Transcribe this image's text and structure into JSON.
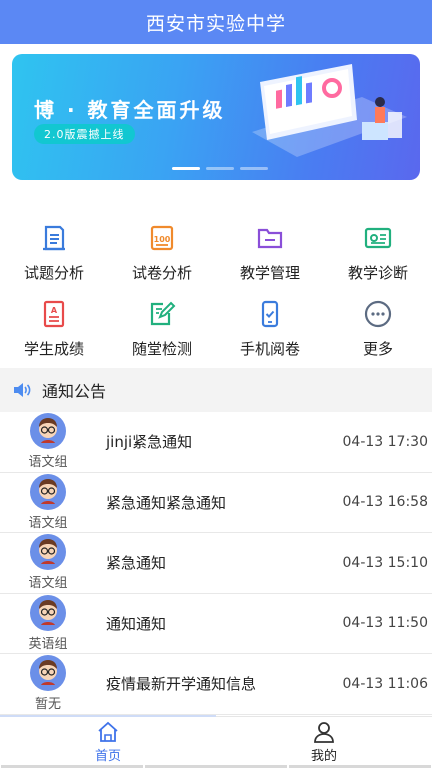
{
  "header": {
    "title": "西安市实验中学"
  },
  "banner": {
    "title": "博 · 教育全面升级",
    "badge": "2.0版震撼上线"
  },
  "grid": [
    {
      "label": "试题分析",
      "icon": "document-icon",
      "color": "#3a7bdc"
    },
    {
      "label": "试卷分析",
      "icon": "score-100-icon",
      "color": "#f08a2c"
    },
    {
      "label": "教学管理",
      "icon": "folder-icon",
      "color": "#8a4fd8"
    },
    {
      "label": "教学诊断",
      "icon": "id-card-icon",
      "color": "#21b07e"
    },
    {
      "label": "学生成绩",
      "icon": "report-icon",
      "color": "#e84a4a"
    },
    {
      "label": "随堂检测",
      "icon": "edit-icon",
      "color": "#21b07e"
    },
    {
      "label": "手机阅卷",
      "icon": "phone-check-icon",
      "color": "#3a7bdc"
    },
    {
      "label": "更多",
      "icon": "more-icon",
      "color": "#5c6b82"
    }
  ],
  "notice": {
    "label": "通知公告"
  },
  "items": [
    {
      "group": "语文组",
      "title": "jinji紧急通知",
      "time": "04-13 17:30"
    },
    {
      "group": "语文组",
      "title": "紧急通知紧急通知",
      "time": "04-13 16:58"
    },
    {
      "group": "语文组",
      "title": "紧急通知",
      "time": "04-13 15:10"
    },
    {
      "group": "英语组",
      "title": "通知通知",
      "time": "04-13 11:50"
    },
    {
      "group": "暂无",
      "title": "疫情最新开学通知信息",
      "time": "04-13 11:06"
    }
  ],
  "tabs": [
    {
      "label": "首页"
    },
    {
      "label": "我的"
    }
  ],
  "colors": {
    "primary": "#5b88f4",
    "active_tab": "#3f73ea"
  }
}
